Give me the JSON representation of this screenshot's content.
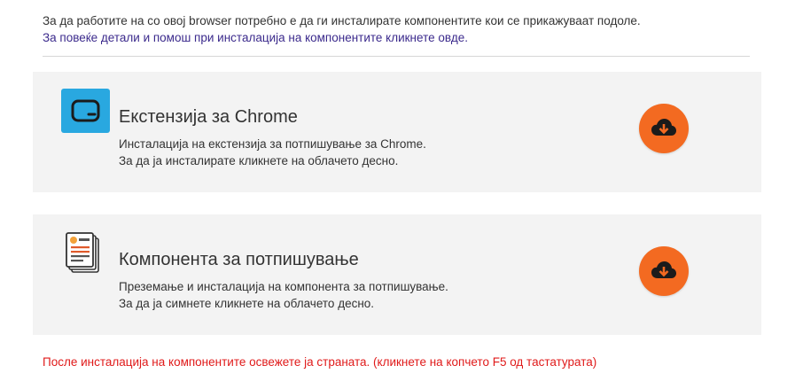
{
  "intro": {
    "line1": "За да работите на со овој browser потребно е да ги инсталирате компонентите кои се прикажуваат подоле.",
    "line2": "За повеќе детали и помош при инсталација на компонентите кликнете овде."
  },
  "cards": [
    {
      "icon": "chrome-extension-app-icon",
      "title": "Екстензија за Chrome",
      "desc_line1": "Инсталација на екстензија за потпишување за Chrome.",
      "desc_line2": "За да ја инсталирате кликнете на облачето десно.",
      "button_icon": "cloud-download-icon"
    },
    {
      "icon": "signing-document-icon",
      "title": "Компонента за потпишување",
      "desc_line1": "Преземање и инсталација на компонента за потпишување.",
      "desc_line2": "За да ја симнете кликнете на облачето десно.",
      "button_icon": "cloud-download-icon"
    }
  ],
  "note": "После инсталација на компонентите освежете ја страната. (кликнете на копчето F5 од тастатурата)",
  "colors": {
    "accent": "#f36a21",
    "link": "#3b2a8c",
    "warning": "#e01a1a",
    "chrome_icon_bg": "#29a8e0"
  }
}
